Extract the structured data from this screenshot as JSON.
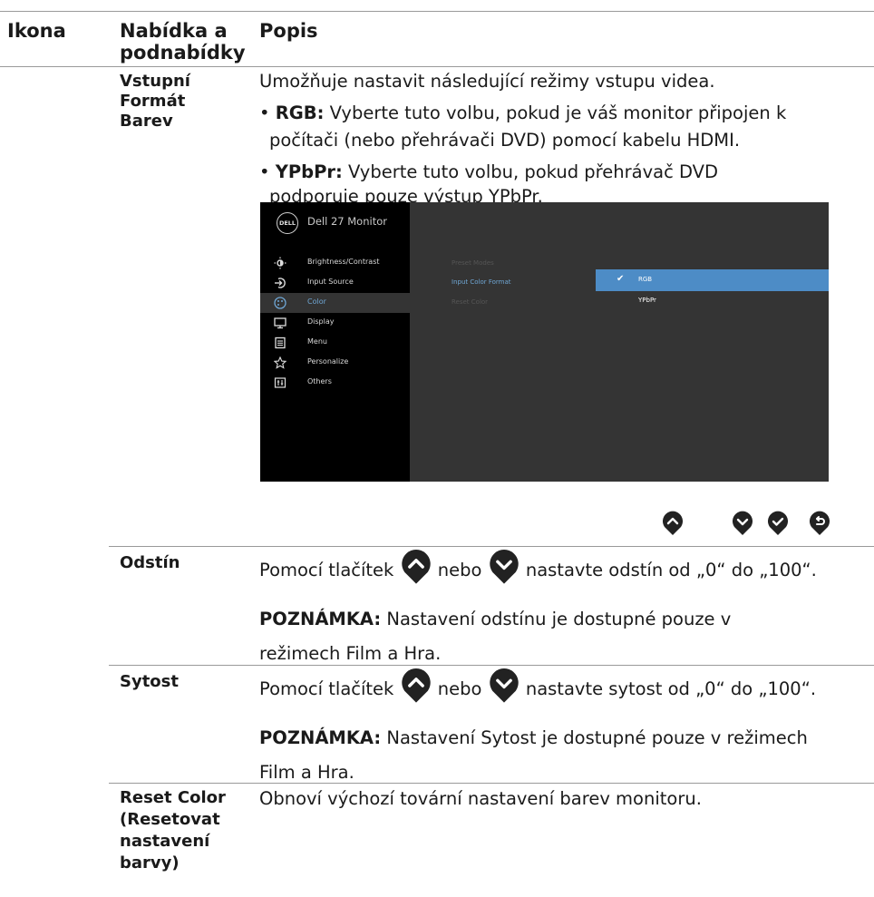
{
  "header": {
    "col_icon": "Ikona",
    "col_menu_line1": "Nabídka a",
    "col_menu_line2": "podnabídky",
    "col_desc": "Popis"
  },
  "rows": {
    "input_format": {
      "label_l1": "Vstupní",
      "label_l2": "Formát",
      "label_l3": "Barev",
      "intro": "Umožňuje nastavit následující režimy vstupu videa.",
      "rgb_term": "RGB:",
      "rgb_text_l1": " Vyberte tuto volbu, pokud je váš monitor připojen k",
      "rgb_text_l2": "počítači (nebo přehrávači DVD) pomocí kabelu HDMI.",
      "ypbpr_term": "YPbPr:",
      "ypbpr_text_l1": " Vyberte tuto volbu, pokud přehrávač DVD",
      "ypbpr_text_l2": "podporuje pouze výstup YPbPr."
    },
    "hue": {
      "label": "Odstín",
      "t1": "Pomocí tlačítek",
      "t2": "nebo",
      "t3": "nastavte odstín od „0“ do „100“.",
      "note_term": "POZNÁMKA:",
      "note_l1": " Nastavení odstínu je dostupné pouze v",
      "note_l2": "režimech Film a Hra."
    },
    "saturation": {
      "label": "Sytost",
      "t1": "Pomocí tlačítek",
      "t2": "nebo",
      "t3": "nastavte sytost od „0“ do „100“.",
      "note_term": "POZNÁMKA:",
      "note_l1": " Nastavení Sytost je dostupné pouze v režimech",
      "note_l2": "Film a Hra."
    },
    "reset": {
      "label_l1": "Reset Color",
      "label_l2": "(Resetovat",
      "label_l3": "nastavení",
      "label_l4": "barvy)",
      "text": "Obnoví výchozí tovární nastavení barev monitoru."
    }
  },
  "osd": {
    "logo": "DELL",
    "title": "Dell 27 Monitor",
    "menu": [
      {
        "label": "Brightness/Contrast",
        "icon": "brightness-icon"
      },
      {
        "label": "Input Source",
        "icon": "input-source-icon"
      },
      {
        "label": "Color",
        "icon": "palette-icon"
      },
      {
        "label": "Display",
        "icon": "display-icon"
      },
      {
        "label": "Menu",
        "icon": "menu-icon"
      },
      {
        "label": "Personalize",
        "icon": "star-icon"
      },
      {
        "label": "Others",
        "icon": "others-icon"
      }
    ],
    "middle": [
      "Preset Modes",
      "Input Color Format",
      "Reset Color"
    ],
    "options": [
      "RGB",
      "YPbPr"
    ],
    "accent": "#4d8cc6"
  },
  "buttons": [
    "up-button-icon",
    "down-button-icon",
    "check-button-icon",
    "back-button-icon"
  ]
}
